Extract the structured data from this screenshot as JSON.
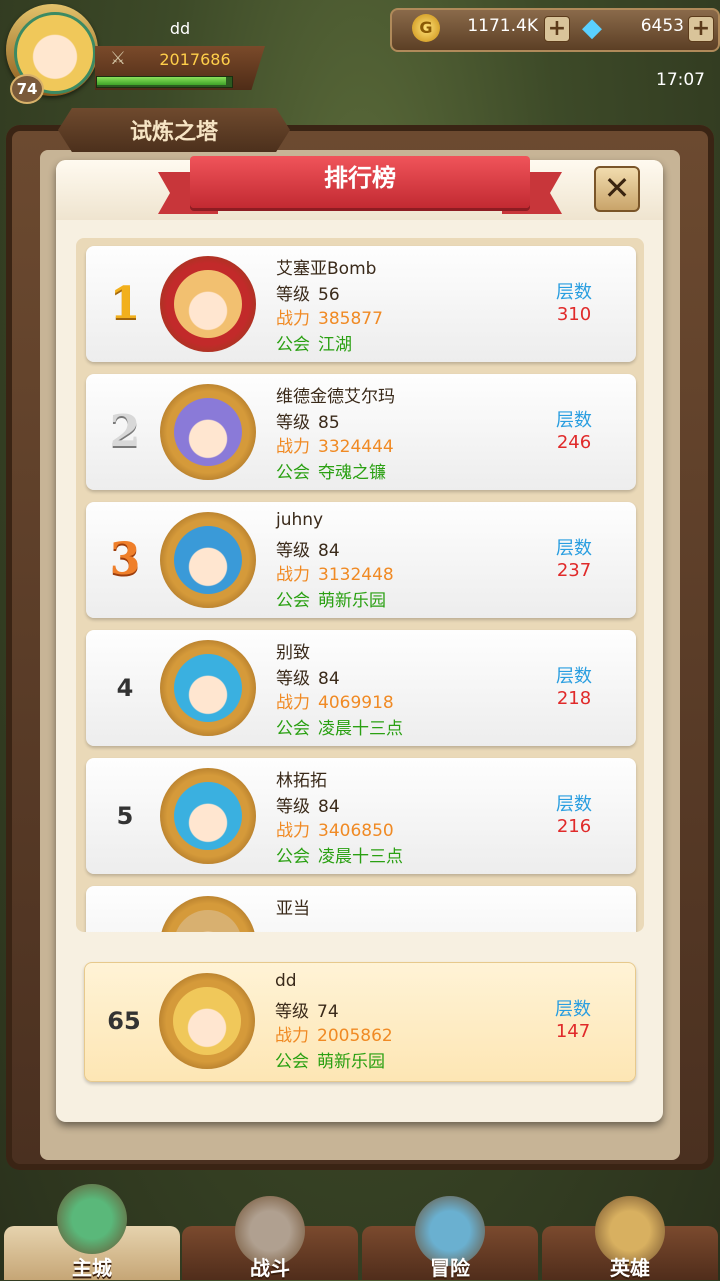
{
  "hud": {
    "player_name": "dd",
    "level": "74",
    "power": "2017686",
    "exp_fraction": 0.96,
    "gold": "1171.4K",
    "gems": "6453",
    "time": "17:07",
    "plus": "+"
  },
  "tab_title": "试炼之塔",
  "dialog": {
    "title": "排行榜",
    "close_symbol": "✕",
    "labels": {
      "level": "等级",
      "power": "战力",
      "guild": "公会",
      "floor": "层数"
    }
  },
  "rankings": [
    {
      "rank": "1",
      "name": "艾塞亚Bomb",
      "level": "56",
      "power": "385877",
      "guild": "江湖",
      "floor": "310",
      "frame_color": "#c22a2a",
      "face_color": "#f2c070"
    },
    {
      "rank": "2",
      "name": "维德金德艾尔玛",
      "level": "85",
      "power": "3324444",
      "guild": "夺魂之镰",
      "floor": "246",
      "frame_color": "#d59a3a",
      "face_color": "#8a7ad8"
    },
    {
      "rank": "3",
      "name": "juhny",
      "level": "84",
      "power": "3132448",
      "guild": "萌新乐园",
      "floor": "237",
      "frame_color": "#d59a3a",
      "face_color": "#3a9ad8"
    },
    {
      "rank": "4",
      "name": "别致",
      "level": "84",
      "power": "4069918",
      "guild": "凌晨十三点",
      "floor": "218",
      "frame_color": "#d59a3a",
      "face_color": "#3ab0e0"
    },
    {
      "rank": "5",
      "name": "林拓拓",
      "level": "84",
      "power": "3406850",
      "guild": "凌晨十三点",
      "floor": "216",
      "frame_color": "#d59a3a",
      "face_color": "#3ab0e0"
    },
    {
      "rank": "",
      "name": "亚当",
      "level": "",
      "power": "",
      "guild": "",
      "floor": "",
      "frame_color": "#d59a3a",
      "face_color": "#d8b070"
    }
  ],
  "self": {
    "rank": "65",
    "name": "dd",
    "level": "74",
    "power": "2005862",
    "guild": "萌新乐园",
    "floor": "147",
    "frame_color": "#d59a3a",
    "face_color": "#f0c85a"
  },
  "nav": [
    {
      "label": "主城",
      "icon": "castle-icon",
      "active": true
    },
    {
      "label": "战斗",
      "icon": "crossed-swords-icon",
      "active": false
    },
    {
      "label": "冒险",
      "icon": "scroll-map-icon",
      "active": false
    },
    {
      "label": "英雄",
      "icon": "hero-emblem-icon",
      "active": false
    }
  ]
}
